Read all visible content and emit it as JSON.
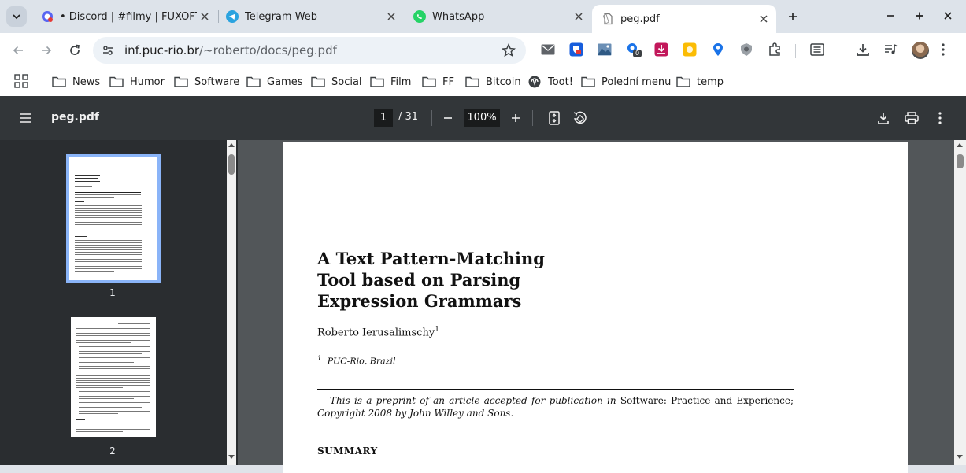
{
  "tabs": [
    {
      "title": "• Discord | #filmy | FUXOFT",
      "favicon": "discord-icon",
      "active": false
    },
    {
      "title": "Telegram Web",
      "favicon": "telegram-icon",
      "active": false
    },
    {
      "title": "WhatsApp",
      "favicon": "whatsapp-icon",
      "active": false
    },
    {
      "title": "peg.pdf",
      "favicon": "pdf-file-icon",
      "active": true
    }
  ],
  "address_bar": {
    "host": "inf.puc-rio.br",
    "path": "/~roberto/docs/peg.pdf"
  },
  "extensions": [
    {
      "name": "mail-icon"
    },
    {
      "name": "bitwarden-icon"
    },
    {
      "name": "image-viewer-icon"
    },
    {
      "name": "extension-counter-icon",
      "badge": "0"
    },
    {
      "name": "download-manager-icon"
    },
    {
      "name": "notes-icon"
    },
    {
      "name": "location-icon"
    },
    {
      "name": "privacy-icon"
    },
    {
      "name": "extensions-puzzle-icon"
    }
  ],
  "bookmarks": [
    {
      "label": "News",
      "icon": "folder-icon"
    },
    {
      "label": "Humor",
      "icon": "folder-icon"
    },
    {
      "label": "Software",
      "icon": "folder-icon"
    },
    {
      "label": "Games",
      "icon": "folder-icon"
    },
    {
      "label": "Social",
      "icon": "folder-icon"
    },
    {
      "label": "Film",
      "icon": "folder-icon"
    },
    {
      "label": "FF",
      "icon": "folder-icon"
    },
    {
      "label": "Bitcoin",
      "icon": "folder-icon"
    },
    {
      "label": "Toot!",
      "icon": "mastodon-icon"
    },
    {
      "label": "Polední menu",
      "icon": "folder-icon"
    },
    {
      "label": "temp",
      "icon": "folder-icon"
    }
  ],
  "pdf_viewer": {
    "title": "peg.pdf",
    "current_page": "1",
    "total_pages": "/ 31",
    "zoom": "100%",
    "thumbnails": [
      {
        "label": "1",
        "selected": true
      },
      {
        "label": "2",
        "selected": false
      }
    ]
  },
  "document": {
    "title": "A Text Pattern-Matching\nTool based on Parsing\nExpression Grammars",
    "author": "Roberto Ierusalimschy",
    "author_sup": "1",
    "affiliation_sup": "1",
    "affiliation": "PUC-Rio, Brazil",
    "note_part1": "This is a preprint of an article accepted for publication in ",
    "note_journal": "Software: Practice and Experience;",
    "note_part2": " Copyright 2008 by John Willey and Sons.",
    "section": "SUMMARY"
  },
  "colors": {
    "accent": "#8ab4f8",
    "viewer_toolbar": "#323639",
    "viewer_bg": "#525659",
    "tab_strip": "#dde3ea"
  }
}
